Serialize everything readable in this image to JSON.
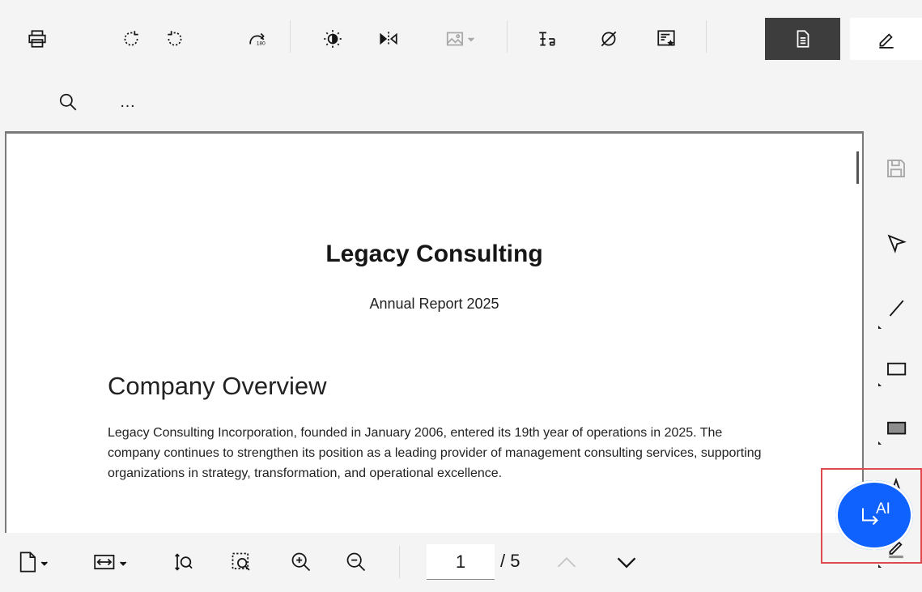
{
  "toolbar": {
    "icons": [
      "printer-icon",
      "rotate-clockwise-icon",
      "rotate-counterclockwise-icon",
      "rotate-180-icon",
      "brightness-icon",
      "flip-horizontal-icon",
      "image-dropdown-icon",
      "text-size-icon",
      "hide-icon",
      "bookmark-star-icon",
      "document-view-icon",
      "edit-annotate-icon",
      "search-icon"
    ],
    "more_label": "…"
  },
  "document": {
    "title": "Legacy Consulting",
    "subtitle": "Annual Report 2025",
    "heading": "Company Overview",
    "paragraph": "Legacy Consulting Incorporation, founded in January 2006, entered its 19th year of operations in 2025. The company continues to strengthen its position as a leading provider of management consulting services, supporting organizations in strategy, transformation, and operational excellence."
  },
  "rail": {
    "icons": [
      "save-icon",
      "select-pointer-icon",
      "line-tool-icon",
      "rectangle-outline-icon",
      "rectangle-filled-icon",
      "text-tool-icon",
      "pen-tool-icon"
    ]
  },
  "pager": {
    "current_page": "1",
    "total_label": "/ 5"
  },
  "ai_button": {
    "label": "AI"
  },
  "colors": {
    "accent": "#0f62fe",
    "highlight": "#e04a4f",
    "active_mode": "#3d3d3d"
  }
}
